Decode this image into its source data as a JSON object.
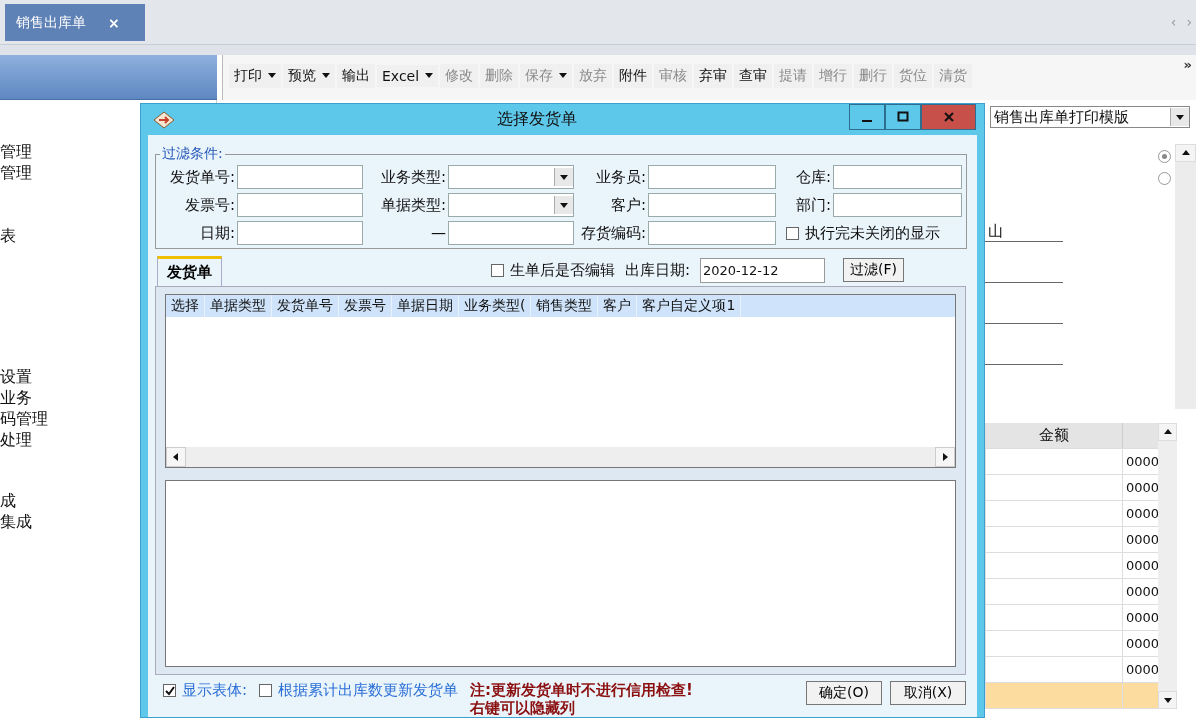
{
  "document_tabs": [
    {
      "label": "销售出库单",
      "selected": true,
      "close": "×"
    }
  ],
  "tab_nav": [
    "‹",
    "›"
  ],
  "sidebar": {
    "items": [
      "管理",
      "管理",
      "表",
      "设置",
      "业务",
      "码管理",
      "处理",
      "成",
      "集成"
    ]
  },
  "toolbar": {
    "items": [
      {
        "label": "打印",
        "dropdown": true,
        "disabled": false
      },
      {
        "label": "预览",
        "dropdown": true,
        "disabled": false
      },
      {
        "label": "输出",
        "dropdown": false,
        "disabled": false
      },
      {
        "label": "Excel",
        "dropdown": true,
        "disabled": false
      },
      {
        "label": "修改",
        "dropdown": false,
        "disabled": true
      },
      {
        "label": "删除",
        "dropdown": false,
        "disabled": true
      },
      {
        "label": "保存",
        "dropdown": true,
        "disabled": true
      },
      {
        "label": "放弃",
        "dropdown": false,
        "disabled": true
      },
      {
        "label": "附件",
        "dropdown": false,
        "disabled": false
      },
      {
        "label": "审核",
        "dropdown": false,
        "disabled": true
      },
      {
        "label": "弃审",
        "dropdown": false,
        "disabled": false
      },
      {
        "label": "查审",
        "dropdown": false,
        "disabled": false
      },
      {
        "label": "提请",
        "dropdown": false,
        "disabled": true
      },
      {
        "label": "增行",
        "dropdown": false,
        "disabled": true
      },
      {
        "label": "删行",
        "dropdown": false,
        "disabled": true
      },
      {
        "label": "货位",
        "dropdown": false,
        "disabled": true
      },
      {
        "label": "清货",
        "dropdown": false,
        "disabled": true
      }
    ],
    "overflow": "»"
  },
  "print_template": {
    "value": "销售出库单打印模版"
  },
  "radios": [
    {
      "selected": true
    },
    {
      "selected": false
    }
  ],
  "form_fields": [
    {
      "value": "山"
    }
  ],
  "amount_table": {
    "columns": [
      "金额"
    ],
    "rows": [
      {
        "value": "0000",
        "highlighted": false
      },
      {
        "value": "0000",
        "highlighted": false
      },
      {
        "value": "0000",
        "highlighted": false
      },
      {
        "value": "0000",
        "highlighted": false
      },
      {
        "value": "0000",
        "highlighted": false
      },
      {
        "value": "0000",
        "highlighted": false
      },
      {
        "value": "0000",
        "highlighted": false
      },
      {
        "value": "0000",
        "highlighted": false
      },
      {
        "value": "0000",
        "highlighted": false
      },
      {
        "highlighted": true
      }
    ]
  },
  "dialog": {
    "title": "选择发货单",
    "filter": {
      "legend": "过滤条件:",
      "fields": [
        {
          "kind": "input",
          "label": "发货单号:"
        },
        {
          "kind": "select",
          "label": "业务类型:"
        },
        {
          "kind": "input",
          "label": "业务员:"
        },
        {
          "kind": "input",
          "label": "仓库:"
        },
        {
          "kind": "input",
          "label": "发票号:"
        },
        {
          "kind": "select",
          "label": "单据类型:"
        },
        {
          "kind": "input",
          "label": "客户:"
        },
        {
          "kind": "input",
          "label": "部门:"
        },
        {
          "kind": "input",
          "label": "日期:"
        },
        {
          "kind": "input",
          "label": "—"
        },
        {
          "kind": "input",
          "label": "存货编码:"
        },
        {
          "kind": "checkbox",
          "label": "执行完未关闭的显示",
          "checked": false
        }
      ]
    },
    "tabs": [
      {
        "label": "发货单",
        "selected": true
      }
    ],
    "edit_after": {
      "label": "生单后是否编辑",
      "checked": false
    },
    "out_date": {
      "label": "出库日期:",
      "value": "2020-12-12"
    },
    "filter_button": "过滤(F)",
    "grid": {
      "columns": [
        "选择",
        "单据类型",
        "发货单号",
        "发票号",
        "单据日期",
        "业务类型(",
        "销售类型",
        "客户",
        "客户自定义项1"
      ]
    },
    "footer": {
      "checkboxes": [
        {
          "label": "显示表体:",
          "checked": true
        },
        {
          "label": "根据累计出库数更新发货单",
          "checked": false
        }
      ],
      "notes": [
        "注:更新发货单时不进行信用检查!",
        "右键可以隐藏列"
      ],
      "buttons": [
        "确定(O)",
        "取消(X)"
      ]
    }
  }
}
